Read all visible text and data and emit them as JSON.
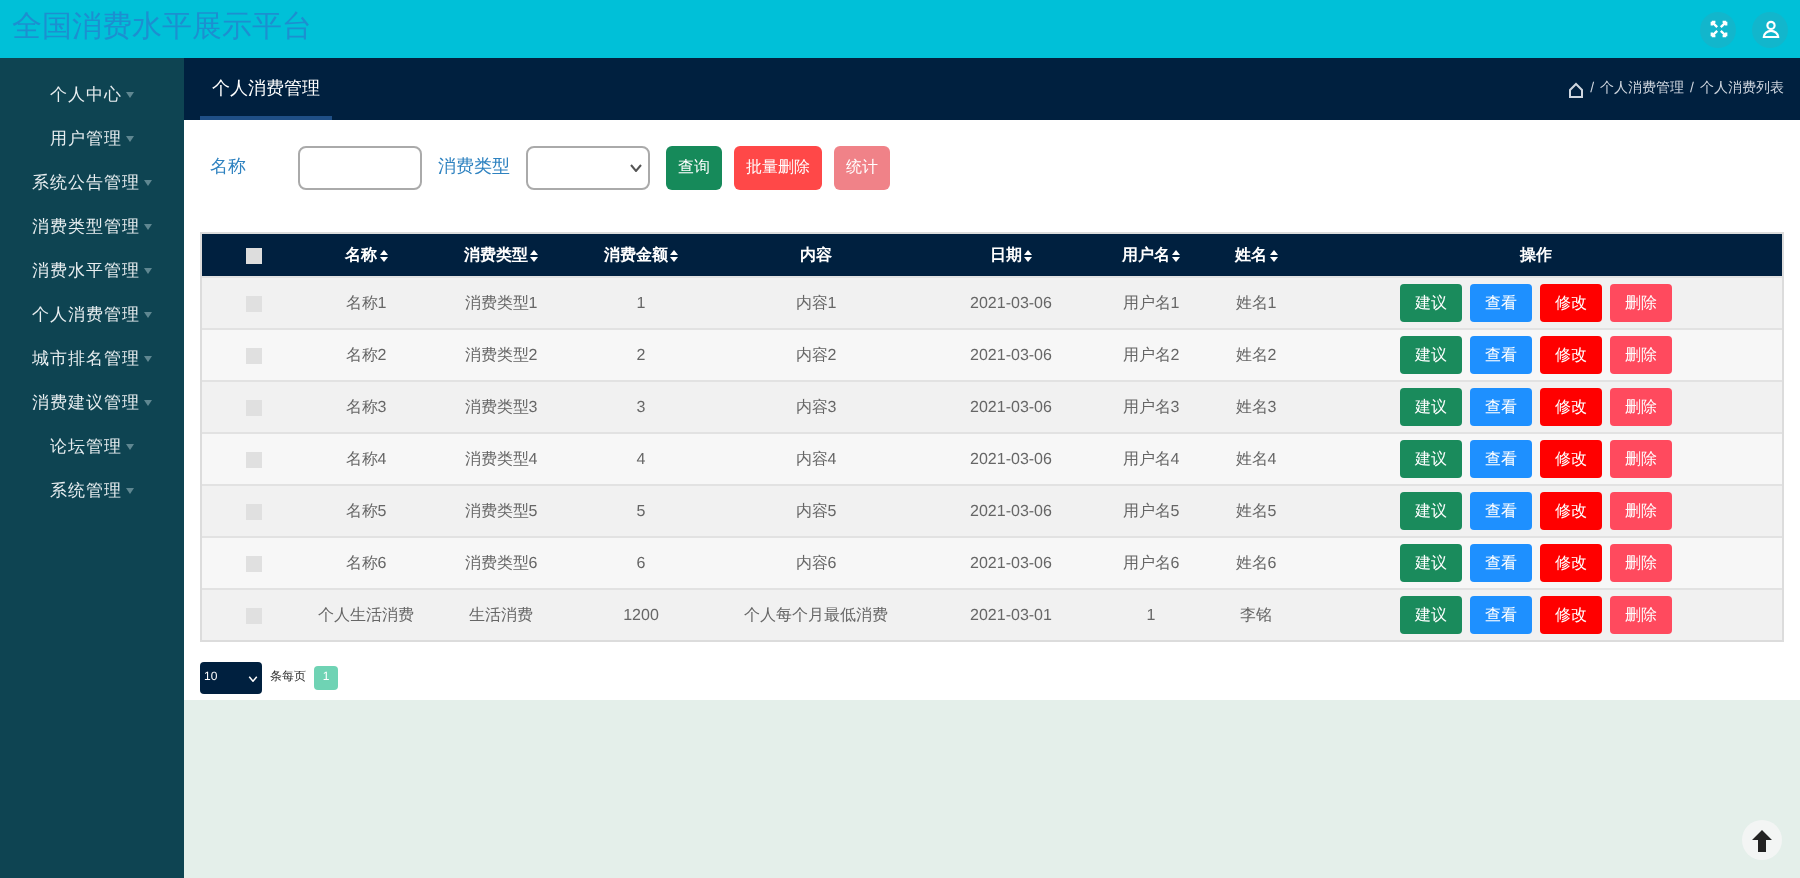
{
  "header": {
    "title": "全国消费水平展示平台"
  },
  "sidebar": {
    "items": [
      {
        "label": "个人中心"
      },
      {
        "label": "用户管理"
      },
      {
        "label": "系统公告管理"
      },
      {
        "label": "消费类型管理"
      },
      {
        "label": "消费水平管理"
      },
      {
        "label": "个人消费管理"
      },
      {
        "label": "城市排名管理"
      },
      {
        "label": "消费建议管理"
      },
      {
        "label": "论坛管理"
      },
      {
        "label": "系统管理"
      }
    ]
  },
  "page_tab": {
    "label": "个人消费管理",
    "selected": true
  },
  "breadcrumb": [
    {
      "separator": "/",
      "label": "个人消费管理"
    },
    {
      "separator": "/",
      "label": "个人消费列表"
    }
  ],
  "search": {
    "name_label": "名称",
    "type_label": "消费类型",
    "buttons": [
      {
        "label": "查询",
        "kind": "query"
      },
      {
        "label": "批量删除",
        "kind": "batch-delete"
      },
      {
        "label": "统计",
        "kind": "stats"
      }
    ]
  },
  "table": {
    "columns": [
      {
        "label": "名称",
        "sortable": true
      },
      {
        "label": "消费类型",
        "sortable": true
      },
      {
        "label": "消费金额",
        "sortable": true
      },
      {
        "label": "内容",
        "sortable": false
      },
      {
        "label": "日期",
        "sortable": true
      },
      {
        "label": "用户名",
        "sortable": true
      },
      {
        "label": "姓名",
        "sortable": true
      },
      {
        "label": "操作",
        "sortable": false
      }
    ],
    "select_all_checked": false,
    "rows": [
      {
        "checked": false,
        "cells": [
          "名称1",
          "消费类型1",
          "1",
          "内容1",
          "2021-03-06",
          "用户名1",
          "姓名1"
        ],
        "actions": [
          {
            "label": "建议",
            "kind": "suggest"
          },
          {
            "label": "查看",
            "kind": "view"
          },
          {
            "label": "修改",
            "kind": "edit"
          },
          {
            "label": "删除",
            "kind": "delete"
          }
        ]
      },
      {
        "checked": false,
        "cells": [
          "名称2",
          "消费类型2",
          "2",
          "内容2",
          "2021-03-06",
          "用户名2",
          "姓名2"
        ],
        "actions": [
          {
            "label": "建议",
            "kind": "suggest"
          },
          {
            "label": "查看",
            "kind": "view"
          },
          {
            "label": "修改",
            "kind": "edit"
          },
          {
            "label": "删除",
            "kind": "delete"
          }
        ]
      },
      {
        "checked": false,
        "cells": [
          "名称3",
          "消费类型3",
          "3",
          "内容3",
          "2021-03-06",
          "用户名3",
          "姓名3"
        ],
        "actions": [
          {
            "label": "建议",
            "kind": "suggest"
          },
          {
            "label": "查看",
            "kind": "view"
          },
          {
            "label": "修改",
            "kind": "edit"
          },
          {
            "label": "删除",
            "kind": "delete"
          }
        ]
      },
      {
        "checked": false,
        "cells": [
          "名称4",
          "消费类型4",
          "4",
          "内容4",
          "2021-03-06",
          "用户名4",
          "姓名4"
        ],
        "actions": [
          {
            "label": "建议",
            "kind": "suggest"
          },
          {
            "label": "查看",
            "kind": "view"
          },
          {
            "label": "修改",
            "kind": "edit"
          },
          {
            "label": "删除",
            "kind": "delete"
          }
        ]
      },
      {
        "checked": false,
        "cells": [
          "名称5",
          "消费类型5",
          "5",
          "内容5",
          "2021-03-06",
          "用户名5",
          "姓名5"
        ],
        "actions": [
          {
            "label": "建议",
            "kind": "suggest"
          },
          {
            "label": "查看",
            "kind": "view"
          },
          {
            "label": "修改",
            "kind": "edit"
          },
          {
            "label": "删除",
            "kind": "delete"
          }
        ]
      },
      {
        "checked": false,
        "cells": [
          "名称6",
          "消费类型6",
          "6",
          "内容6",
          "2021-03-06",
          "用户名6",
          "姓名6"
        ],
        "actions": [
          {
            "label": "建议",
            "kind": "suggest"
          },
          {
            "label": "查看",
            "kind": "view"
          },
          {
            "label": "修改",
            "kind": "edit"
          },
          {
            "label": "删除",
            "kind": "delete"
          }
        ]
      },
      {
        "checked": false,
        "cells": [
          "个人生活消费",
          "生活消费",
          "1200",
          "个人每个月最低消费",
          "2021-03-01",
          "1",
          "李铭"
        ],
        "actions": [
          {
            "label": "建议",
            "kind": "suggest"
          },
          {
            "label": "查看",
            "kind": "view"
          },
          {
            "label": "修改",
            "kind": "edit"
          },
          {
            "label": "删除",
            "kind": "delete"
          }
        ]
      }
    ]
  },
  "pagination": {
    "page_size": "10",
    "per_page_label": "条每页",
    "pages": [
      {
        "label": "1",
        "selected": true
      }
    ]
  }
}
